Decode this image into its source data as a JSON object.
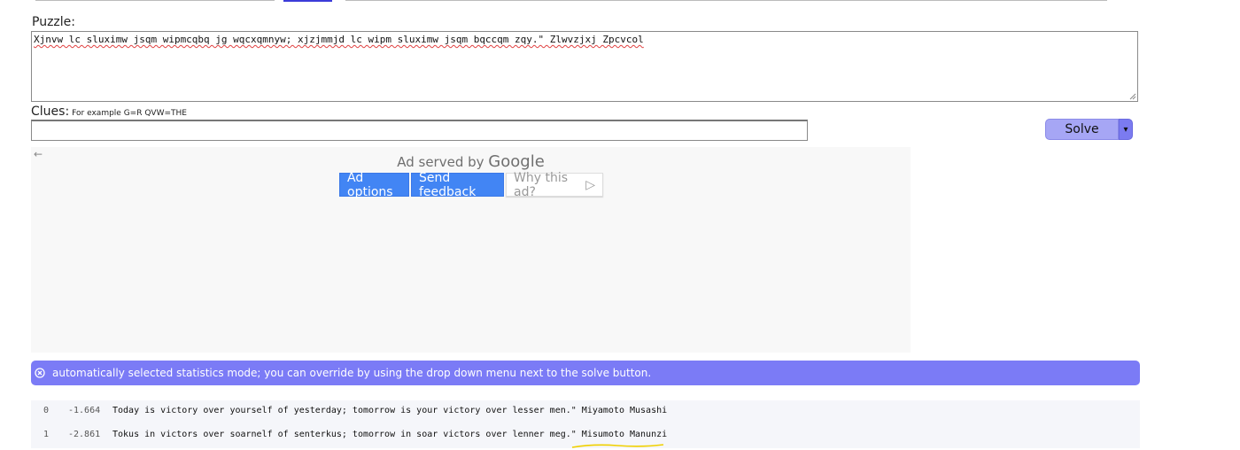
{
  "puzzle": {
    "label": "Puzzle:",
    "text": "Xjnvw lc sluximw jsqm wipmcqbq jg wqcxqmnyw; xjzjmmjd lc wipm sluximw jsqm bqccqm zqy.\" Zlwvzjxj Zpcvcol"
  },
  "clues": {
    "label": "Clues:",
    "hint": "For example G=R QVW=THE",
    "value": ""
  },
  "solve": {
    "label": "Solve",
    "dropdown_glyph": "▾"
  },
  "ad": {
    "back_glyph": "←",
    "served_by": "Ad served by",
    "brand": "Google",
    "options_label": "Ad options",
    "feedback_label": "Send feedback",
    "why_label": "Why this ad?",
    "why_glyph": "▷"
  },
  "info": {
    "message": "automatically selected statistics mode; you can override by using the drop down menu next to the solve button."
  },
  "results": [
    {
      "index": "0",
      "score": "-1.664",
      "text": "Today is victory over yourself of yesterday; tomorrow is your victory over lesser men.\" Miyamoto Musashi"
    },
    {
      "index": "1",
      "score": "-2.861",
      "text": "Tokus in victors over soarnelf of senterkus; tomorrow in soar victors over lenner meg.\" Misumoto Manunzi"
    }
  ],
  "colors": {
    "solve_button": "#a6a6f5",
    "solve_dropdown": "#7b7bf0",
    "info_bar": "#7b7bf6",
    "google_blue": "#4285f4",
    "annotation_yellow": "#f0d000"
  }
}
